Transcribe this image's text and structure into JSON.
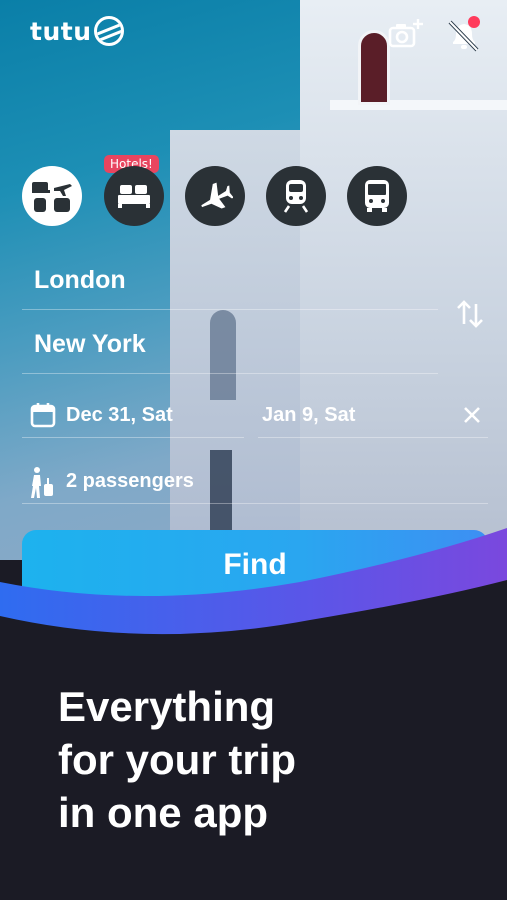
{
  "app": {
    "logo_text": "tutu"
  },
  "topbar": {
    "camera_icon": "camera-plus-icon",
    "bell_icon": "bell-off-icon",
    "notification_dot_color": "#ff3b5c"
  },
  "modes": {
    "badge": "Hotels!",
    "items": [
      {
        "name": "all-transport",
        "icon": "combo-icon",
        "active": true
      },
      {
        "name": "hotels",
        "icon": "bed-icon",
        "active": false
      },
      {
        "name": "flights",
        "icon": "plane-icon",
        "active": false
      },
      {
        "name": "trains",
        "icon": "train-icon",
        "active": false
      },
      {
        "name": "buses",
        "icon": "bus-icon",
        "active": false
      }
    ]
  },
  "search": {
    "from": "London",
    "to": "New York",
    "depart": "Dec 31, Sat",
    "return": "Jan 9, Sat",
    "passengers": "2 passengers",
    "find_label": "Find"
  },
  "promo": {
    "line1": "Everything",
    "line2": "for your trip",
    "line3": "in one app"
  },
  "colors": {
    "accent": "#1db2ee",
    "badge": "#e8455f",
    "dark_panel": "#1b1b25"
  }
}
